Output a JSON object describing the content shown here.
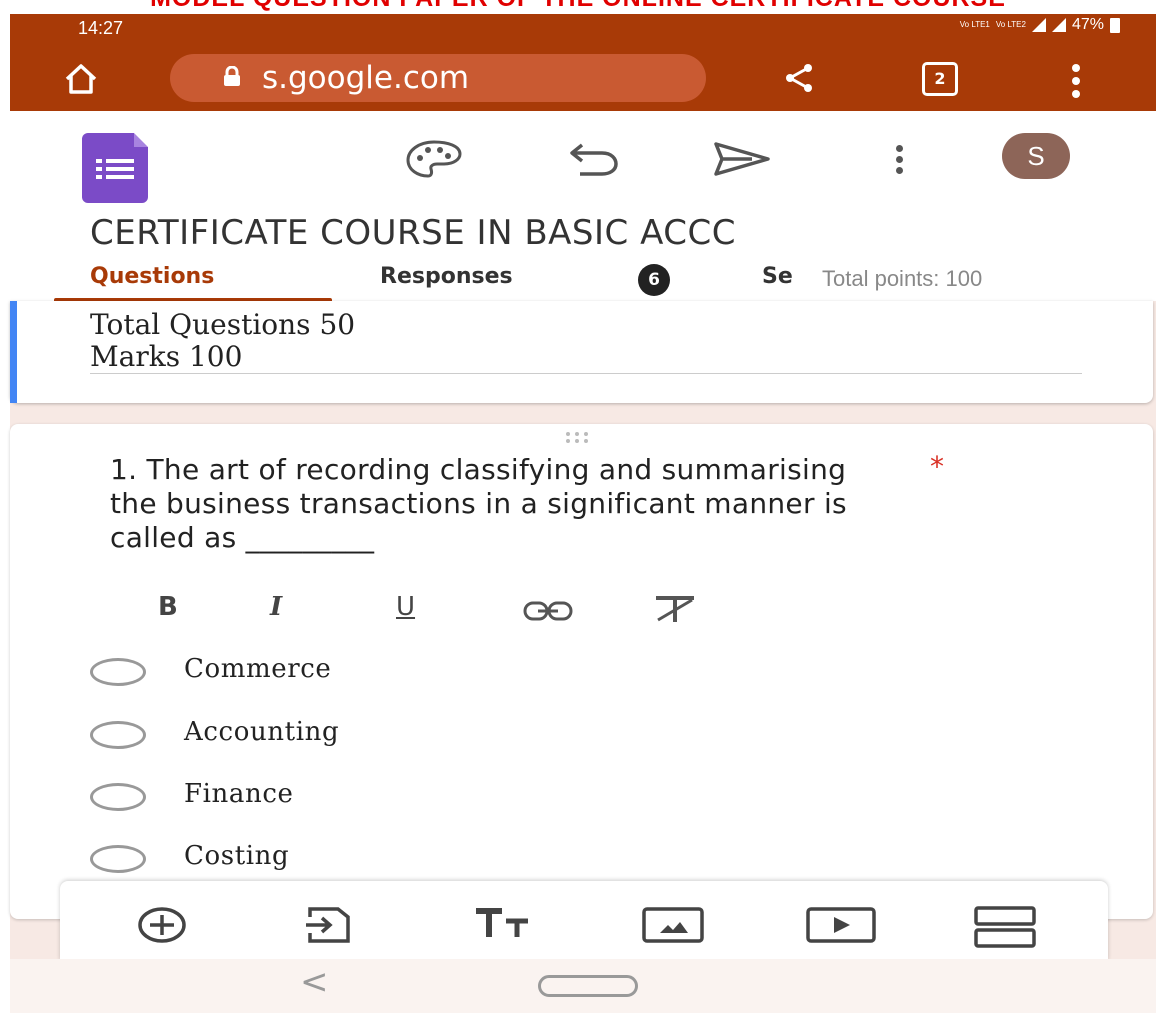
{
  "banner": {
    "text": "MODEL QUESTION PAPER OF THE ONLINE CERTIFICATE COURSE"
  },
  "status_bar": {
    "time": "14:27",
    "volte_1": "Vo LTE1",
    "volte_2": "Vo LTE2",
    "battery": "47%"
  },
  "browser": {
    "url": "s.google.com",
    "tab_count": "2"
  },
  "form_toolbar": {
    "avatar_letter": "S"
  },
  "form": {
    "title": "CERTIFICATE COURSE IN BASIC ACCC",
    "tabs": {
      "questions": "Questions",
      "responses": "Responses",
      "responses_count": "6",
      "settings": "Se"
    },
    "total_points": "Total points: 100"
  },
  "description_card": {
    "line1": "Total Questions 50",
    "line2": "Marks 100"
  },
  "question": {
    "text": "1. The art of recording classifying and summarising the business transactions in a significant manner is called as _________",
    "required_mark": "*",
    "format": {
      "bold": "B",
      "italic": "I",
      "underline": "U"
    },
    "options": [
      "Commerce",
      "Accounting",
      "Finance",
      "Costing"
    ]
  },
  "colors": {
    "chrome": "#a83a07",
    "accent_tab": "#a83a07",
    "forms_purple": "#7b4bc7",
    "required": "#d93025",
    "description_accent": "#4285f4"
  },
  "icons": {
    "home": "home-icon",
    "lock": "lock-icon",
    "share": "share-icon",
    "menu": "overflow-menu-icon",
    "palette": "palette-icon",
    "undo": "undo-icon",
    "send": "send-icon",
    "add": "add-question-icon",
    "import": "import-questions-icon",
    "title": "add-title-icon",
    "image": "add-image-icon",
    "video": "add-video-icon",
    "section": "add-section-icon"
  }
}
